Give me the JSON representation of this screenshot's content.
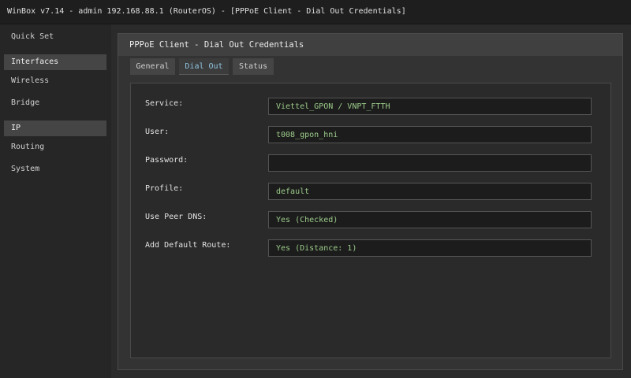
{
  "window": {
    "title": "WinBox v7.14 - admin 192.168.88.1 (RouterOS) - [PPPoE Client - Dial Out Credentials]"
  },
  "sidebar": {
    "items": [
      {
        "label": "Quick Set"
      },
      {
        "label": "Interfaces"
      },
      {
        "label": "Wireless"
      },
      {
        "label": "Bridge"
      },
      {
        "label": "IP"
      },
      {
        "label": "Routing"
      },
      {
        "label": "System"
      }
    ]
  },
  "panel": {
    "title": "PPPoE Client - Dial Out Credentials",
    "tabs": [
      {
        "label": "General"
      },
      {
        "label": "Dial Out"
      },
      {
        "label": "Status"
      }
    ],
    "active_tab": "Dial Out",
    "fields": [
      {
        "label": "Service:",
        "value": "Viettel_GPON / VNPT_FTTH"
      },
      {
        "label": "User:",
        "value": "t008_gpon_hni"
      },
      {
        "label": "Password:",
        "value": ""
      },
      {
        "label": "Profile:",
        "value": "default"
      },
      {
        "label": "Use Peer DNS:",
        "value": "Yes (Checked)"
      },
      {
        "label": "Add Default Route:",
        "value": "Yes (Distance: 1)"
      }
    ]
  },
  "colors": {
    "value_text": "#9ccc8a",
    "active_tab_text": "#8fc3e0"
  }
}
